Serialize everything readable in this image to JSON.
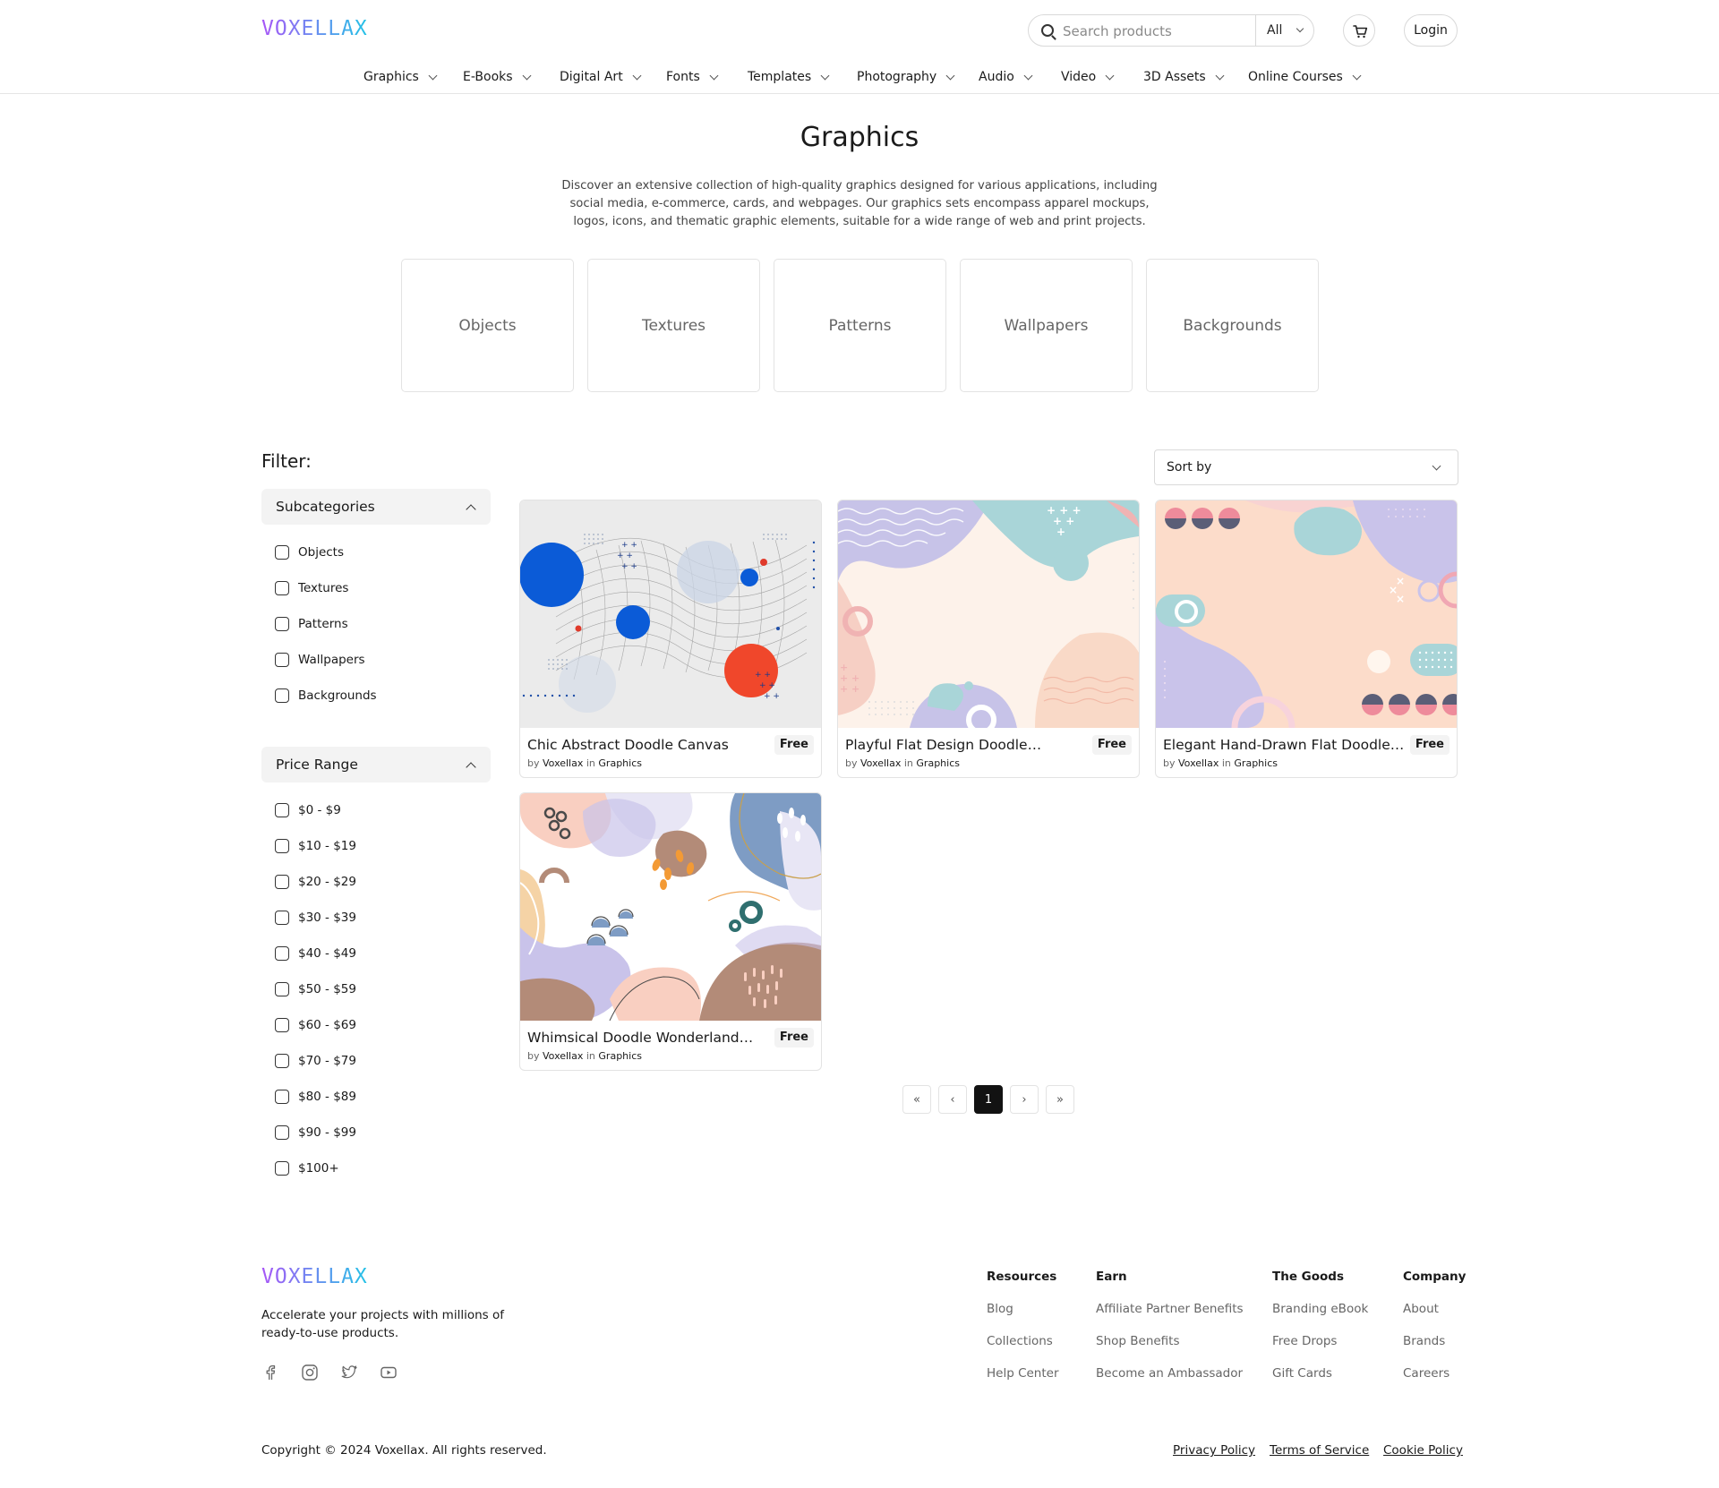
{
  "brand": {
    "name": "VOXELLAX"
  },
  "header": {
    "search_placeholder": "Search products",
    "search_category": "All",
    "login_label": "Login"
  },
  "nav": [
    "Graphics",
    "E-Books",
    "Digital Art",
    "Fonts",
    "Templates",
    "Photography",
    "Audio",
    "Video",
    "3D Assets",
    "Online Courses"
  ],
  "hero": {
    "title": "Graphics",
    "description": "Discover an extensive collection of high-quality graphics designed for various applications, including social media, e-commerce, cards, and webpages. Our graphics sets encompass apparel mockups, logos, icons, and thematic graphic elements, suitable for a wide range of web and print projects."
  },
  "categories": [
    "Objects",
    "Textures",
    "Patterns",
    "Wallpapers",
    "Backgrounds"
  ],
  "filter": {
    "title": "Filter:",
    "subcategories_title": "Subcategories",
    "subcategories": [
      "Objects",
      "Textures",
      "Patterns",
      "Wallpapers",
      "Backgrounds"
    ],
    "price_title": "Price Range",
    "price_ranges": [
      "$0 - $9",
      "$10 - $19",
      "$20 - $29",
      "$30 - $39",
      "$40 - $49",
      "$50 - $59",
      "$60 - $69",
      "$70 - $79",
      "$80 - $89",
      "$90 - $99",
      "$100+"
    ]
  },
  "sort": {
    "label": "Sort by"
  },
  "products": [
    {
      "name": "Chic Abstract Doodle Canvas",
      "price": "Free",
      "by": "by",
      "author": "Voxellax",
      "in": "in",
      "category": "Graphics"
    },
    {
      "name": "Playful Flat Design Doodle…",
      "price": "Free",
      "by": "by",
      "author": "Voxellax",
      "in": "in",
      "category": "Graphics"
    },
    {
      "name": "Elegant Hand-Drawn Flat Doodle…",
      "price": "Free",
      "by": "by",
      "author": "Voxellax",
      "in": "in",
      "category": "Graphics"
    },
    {
      "name": "Whimsical Doodle Wonderland…",
      "price": "Free",
      "by": "by",
      "author": "Voxellax",
      "in": "in",
      "category": "Graphics"
    }
  ],
  "pagination": {
    "first": "«",
    "prev": "‹",
    "current": "1",
    "next": "›",
    "last": "»"
  },
  "footer": {
    "tagline": "Accelerate your projects with millions of ready-to-use products.",
    "social_icons": [
      "facebook-icon",
      "instagram-icon",
      "twitter-icon",
      "youtube-icon"
    ],
    "columns": [
      {
        "title": "Resources",
        "links": [
          "Blog",
          "Collections",
          "Help Center"
        ]
      },
      {
        "title": "Earn",
        "links": [
          "Affiliate Partner Benefits",
          "Shop Benefits",
          "Become an Ambassador"
        ]
      },
      {
        "title": "The Goods",
        "links": [
          "Branding eBook",
          "Free Drops",
          "Gift Cards"
        ]
      },
      {
        "title": "Company",
        "links": [
          "About",
          "Brands",
          "Careers"
        ]
      }
    ],
    "copyright": "Copyright © 2024 Voxellax. All rights reserved.",
    "legal": [
      "Privacy Policy",
      "Terms of Service",
      "Cookie Policy"
    ]
  },
  "colors": {
    "accent": "#121212",
    "logo_start": "#a855f7",
    "logo_end": "#22c3e6",
    "muted_bg": "#f3f3f3",
    "border": "#e3e3e3"
  }
}
